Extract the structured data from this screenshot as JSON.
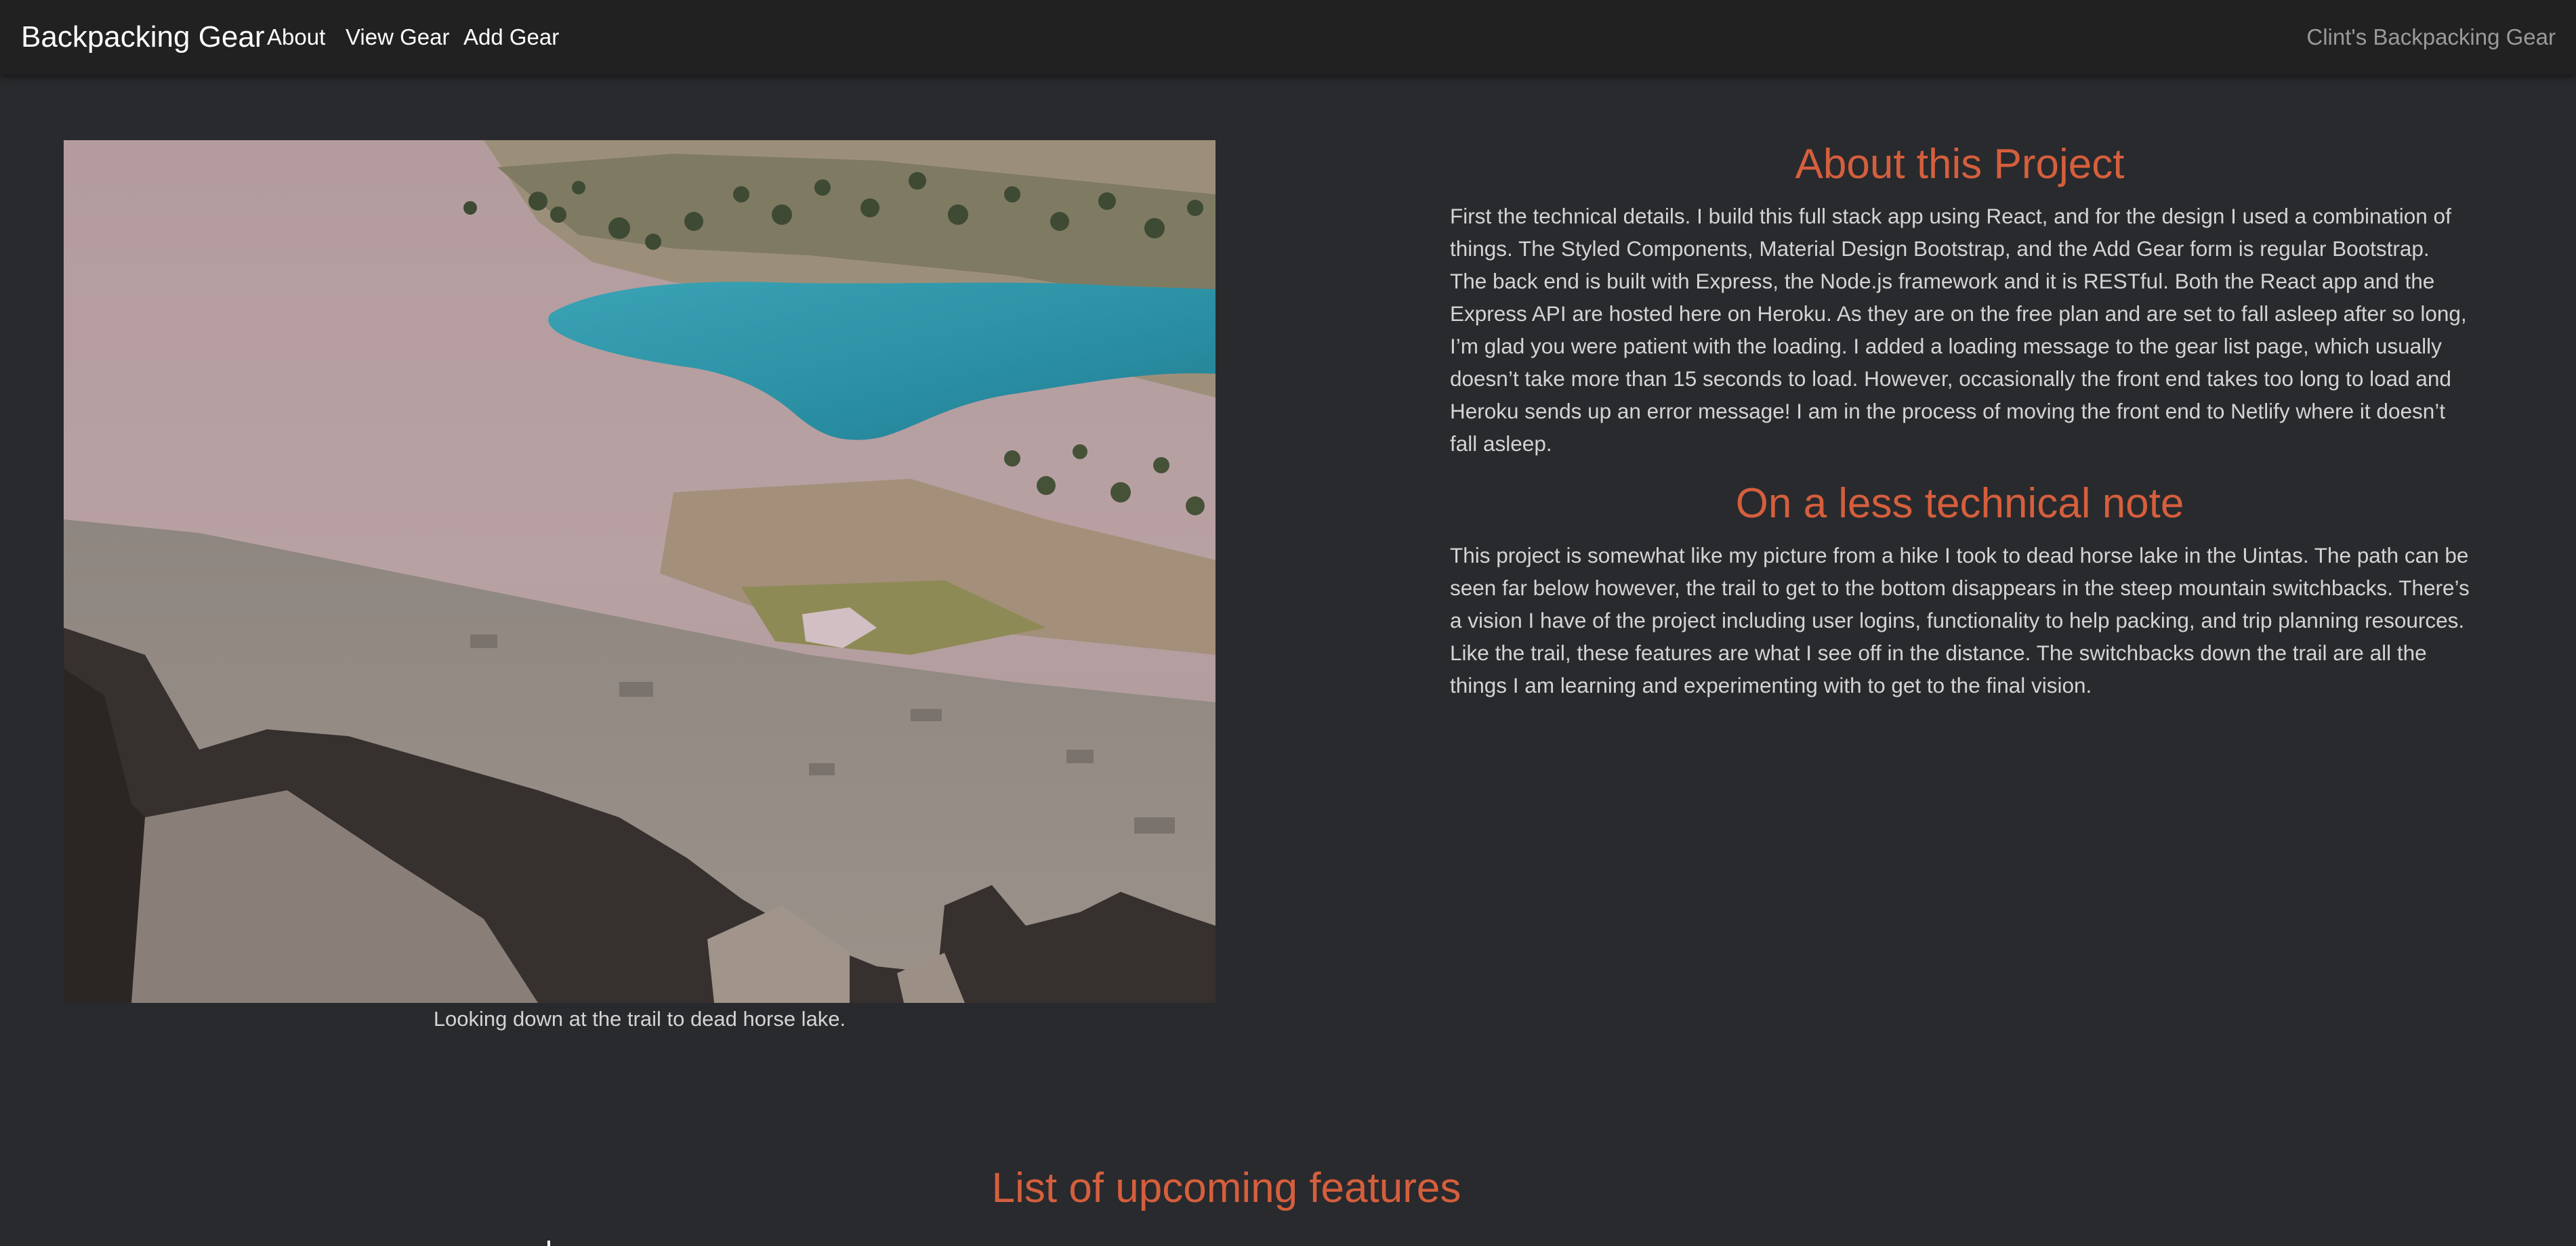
{
  "navbar": {
    "brand": "Backpacking Gear",
    "links": [
      "About",
      "View Gear",
      "Add Gear"
    ],
    "right_text": "Clint's Backpacking Gear"
  },
  "photo": {
    "caption": "Looking down at the trail to dead horse lake."
  },
  "about": {
    "title": "About this Project",
    "text": "First the technical details. I build this full stack app using React, and for the design I used a combination of things. The Styled Components, Material Design Bootstrap, and the Add Gear form is regular Bootstrap. The back end is built with Express, the Node.js framework and it is RESTful. Both the React app and the Express API are hosted here on Heroku. As they are on the free plan and are set to fall asleep after so long, I’m glad you were patient with the loading. I added a loading message to the gear list page, which usually doesn’t take more than 15 seconds to load. However, occasionally the front end takes too long to load and Heroku sends up an error message! I am in the process of moving the front end to Netlify where it doesn’t fall asleep."
  },
  "note": {
    "title": "On a less technical note",
    "text": "This project is somewhat like my picture from a hike I took to dead horse lake in the Uintas. The path can be seen far below however, the trail to get to the bottom disappears in the steep mountain switchbacks. There’s a vision I have of the project including user logins, functionality to help packing, and trip planning resources. Like the trail, these features are what I see off in the distance. The switchbacks down the trail are all the things I am learning and experimenting with to get to the final vision."
  },
  "features": {
    "title": "List of upcoming features"
  },
  "colors": {
    "background": "#292a2d",
    "navbar": "#212121",
    "accent": "#d55f3d",
    "text": "#d4d4d4",
    "muted": "#9a9a9a"
  }
}
